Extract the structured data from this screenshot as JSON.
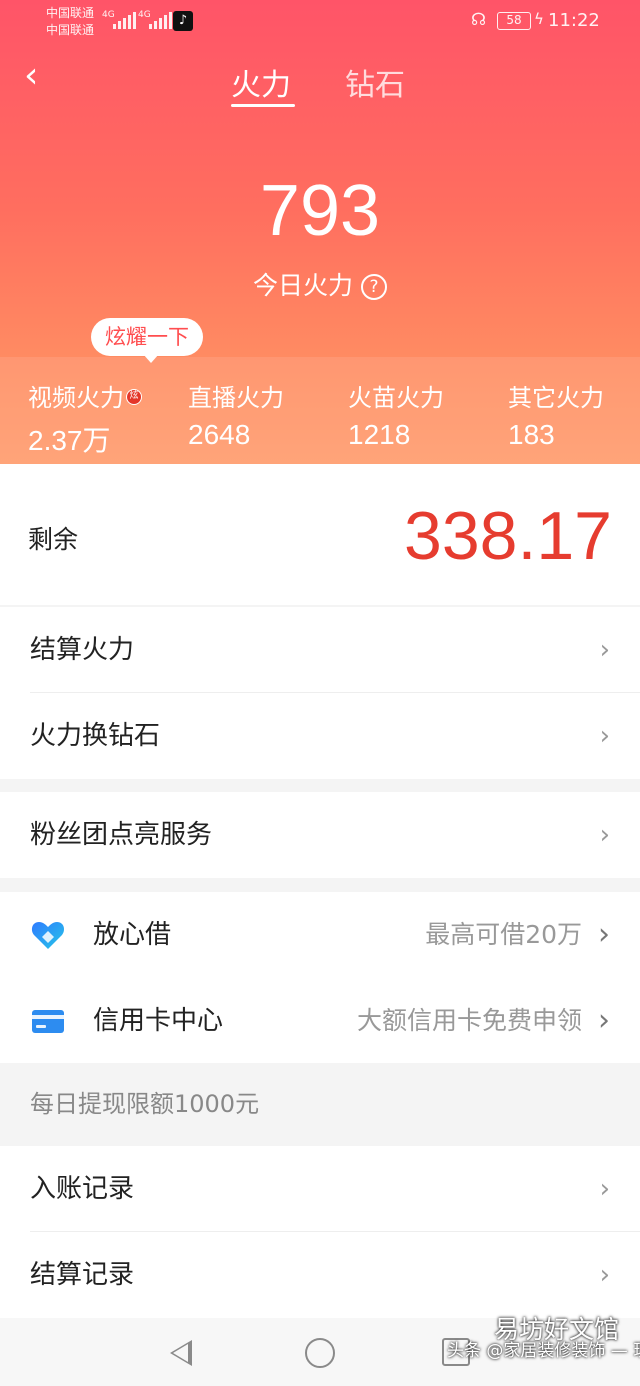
{
  "status_bar": {
    "carrier_1": "中国联通",
    "carrier_2": "中国联通",
    "net_1": "4G",
    "net_2": "4G",
    "battery": "58",
    "time": "11:22"
  },
  "header": {
    "back_icon": "back-arrow-icon",
    "tabs": [
      {
        "label": "火力",
        "active": true
      },
      {
        "label": "钻石",
        "active": false
      }
    ]
  },
  "summary": {
    "today_value": "793",
    "today_label": "今日火力",
    "help_icon_glyph": "?"
  },
  "tooltip": "炫耀一下",
  "stats": [
    {
      "label": "视频火力",
      "value": "2.37万",
      "badge": "炫"
    },
    {
      "label": "直播火力",
      "value": "2648"
    },
    {
      "label": "火苗火力",
      "value": "1218"
    },
    {
      "label": "其它火力",
      "value": "183"
    }
  ],
  "remaining": {
    "label": "剩余",
    "value": "338.17"
  },
  "menu_group_1": [
    {
      "label": "结算火力"
    },
    {
      "label": "火力换钻石"
    }
  ],
  "menu_group_2": [
    {
      "label": "粉丝团点亮服务"
    }
  ],
  "finance": [
    {
      "label": "放心借",
      "sub": "最高可借20万",
      "icon": "heart-loan-icon"
    },
    {
      "label": "信用卡中心",
      "sub": "大额信用卡免费申领",
      "icon": "credit-card-icon"
    }
  ],
  "limit_notice": "每日提现限额1000元",
  "records": [
    {
      "label": "入账记录"
    },
    {
      "label": "结算记录"
    }
  ],
  "watermark": {
    "small": "头条 @家居装修装饰 — 现场",
    "big": "易坊好文馆"
  },
  "colors": {
    "accent_red": "#e63c2f",
    "hero_top": "#ff5468",
    "hero_bottom": "#ff9a6a"
  }
}
